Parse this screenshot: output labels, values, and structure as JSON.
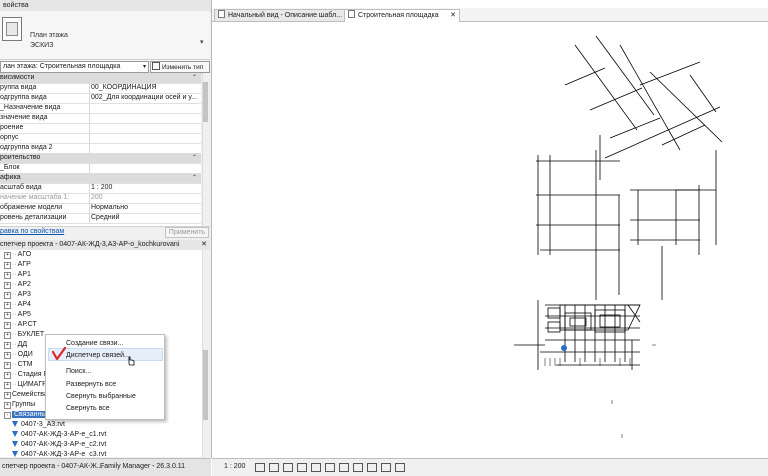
{
  "properties": {
    "title": "войства",
    "type_name_line1": "План этажа",
    "type_name_line2": "ЭСКИЗ",
    "selector_value": "лан этажа: Строительная площадка",
    "edit_type_label": "Изменить тип",
    "rows": [
      {
        "key": "висимости",
        "value": "",
        "section": true,
        "caret": "⌃"
      },
      {
        "key": "руппа вида",
        "value": "00_КООРДИНАЦИЯ"
      },
      {
        "key": "одгруппа вида",
        "value": "002_Для координации осей и у..."
      },
      {
        "key": "_Назначение вида",
        "value": ""
      },
      {
        "key": "значение вида",
        "value": ""
      },
      {
        "key": "роение",
        "value": ""
      },
      {
        "key": "орпус",
        "value": ""
      },
      {
        "key": "одгруппа вида 2",
        "value": ""
      },
      {
        "key": "роительство",
        "value": "",
        "section": true,
        "caret": "⌃"
      },
      {
        "key": "_Блок",
        "value": ""
      },
      {
        "key": "афика",
        "value": "",
        "section": true,
        "caret": "⌃"
      },
      {
        "key": "асштаб вида",
        "value": "1 : 200"
      },
      {
        "key": "начение масштаба   1:",
        "value": "200",
        "disabled": true
      },
      {
        "key": "ображение модели",
        "value": "Нормально"
      },
      {
        "key": "ровень детализации",
        "value": "Средний"
      }
    ],
    "help_link": "равка по свойствам",
    "apply_label": "Применить"
  },
  "project_browser": {
    "title": "спетчер проекта - 0407-АК-ЖД-3,А3-АР-o_kochkurovani",
    "items": [
      {
        "label": "АГО",
        "expandable": true
      },
      {
        "label": "АГР",
        "expandable": true
      },
      {
        "label": "АР1",
        "expandable": true
      },
      {
        "label": "АР2",
        "expandable": true
      },
      {
        "label": "АР3",
        "expandable": true
      },
      {
        "label": "АР4",
        "expandable": true
      },
      {
        "label": "АР5",
        "expandable": true
      },
      {
        "label": "АР.СТ",
        "expandable": true
      },
      {
        "label": "БУКЛЕТ",
        "expandable": true
      },
      {
        "label": "ДД",
        "expandable": true
      },
      {
        "label": "ОДИ",
        "expandable": true
      },
      {
        "label": "СТМ",
        "expandable": true
      },
      {
        "label": "Стадия П",
        "expandable": true
      },
      {
        "label": "ЦИМАГР",
        "expandable": true
      }
    ],
    "families_label": "Семейства",
    "groups_label": "Группы",
    "links_label": "Связанные ...",
    "links": [
      "0407-3_А3.rvt",
      "0407-АК-ЖД-3-АР-е_с1.rvt",
      "0407-АК-ЖД-3-АР-е_с2.rvt",
      "0407-АК-ЖД-3-АР-е_с3.rvt"
    ]
  },
  "context_menu": {
    "items": [
      "Создание связи...",
      "Диспетчер связей...",
      "Поиск...",
      "Развернуть все",
      "Свернуть выбранные",
      "Свернуть все"
    ],
    "hovered_index": 1
  },
  "tabs": [
    {
      "label": "Начальный вид - Описание шабл...",
      "active": false
    },
    {
      "label": "Строительная площадка",
      "active": true
    }
  ],
  "status": {
    "left_text": "спетчер проекта - 0407-АК-Ж...",
    "family_manager": "Family Manager - 26.3.0.11",
    "scale": "1 : 200"
  },
  "colors": {
    "selection": "#3a72c0",
    "link_text": "#0b56b2",
    "check_mark": "#e0262b"
  }
}
